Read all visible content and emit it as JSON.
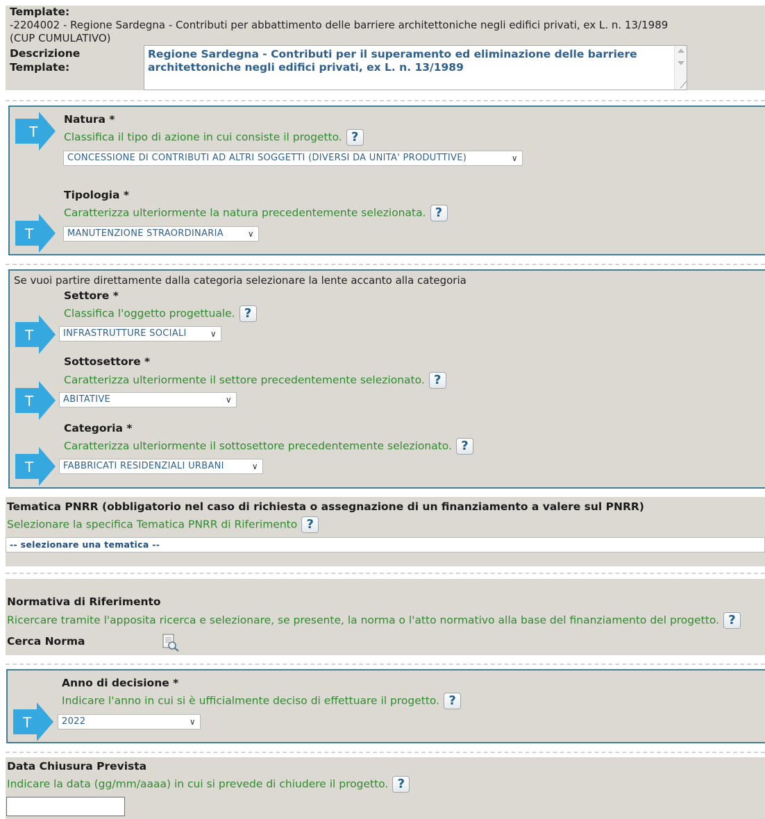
{
  "template": {
    "label": "Template:",
    "value_line1": "-2204002 - Regione Sardegna - Contributi per abbattimento delle barriere architettoniche negli edifici privati, ex L. n. 13/1989",
    "value_line2": "(CUP CUMULATIVO)",
    "descr_label_1": "Descrizione",
    "descr_label_2": "Template:",
    "descr_line1": "Regione Sardegna - Contributi per il superamento ed eliminazione delle barriere",
    "descr_line2": "architettoniche negli edifici privati, ex L. n. 13/1989"
  },
  "natura": {
    "label": "Natura *",
    "hint": "Classifica il tipo di azione in cui consiste il progetto.",
    "value": "CONCESSIONE DI CONTRIBUTI AD ALTRI SOGGETTI (DIVERSI DA UNITA' PRODUTTIVE)"
  },
  "tipologia": {
    "label": "Tipologia *",
    "hint": "Caratterizza ulteriormente la natura precedentemente selezionata.",
    "value": "MANUTENZIONE STRAORDINARIA"
  },
  "category_intro": "Se vuoi partire direttamente dalla categoria selezionare la lente accanto alla categoria",
  "settore": {
    "label": "Settore *",
    "hint": "Classifica l'oggetto progettuale.",
    "value": "INFRASTRUTTURE SOCIALI"
  },
  "sottosettore": {
    "label": "Sottosettore *",
    "hint": "Caratterizza ulteriormente il settore precedentemente selezionato.",
    "value": "ABITATIVE"
  },
  "categoria": {
    "label": "Categoria *",
    "hint": "Caratterizza ulteriormente il sottosettore precedentemente selezionato.",
    "value": "FABBRICATI RESIDENZIALI URBANI"
  },
  "pnrr": {
    "label": "Tematica PNRR (obbligatorio nel caso di richiesta o assegnazione di un finanziamento a valere sul PNRR)",
    "hint": "Selezionare la specifica Tematica PNRR di Riferimento",
    "value": "-- selezionare una tematica --"
  },
  "normativa": {
    "label": "Normativa di Riferimento",
    "hint": "Ricercare tramite l'apposita ricerca e selezionare, se presente, la norma o l'atto normativo alla base del finanziamento del progetto.",
    "search_label": "Cerca Norma"
  },
  "anno": {
    "label": "Anno di decisione *",
    "hint": "Indicare l'anno in cui si è ufficialmente deciso di effettuare il progetto.",
    "value": "2022"
  },
  "chiusura": {
    "label": "Data Chiusura Prevista",
    "hint": "Indicare la data (gg/mm/aaaa) in cui si prevede di chiudere il progetto.",
    "value": ""
  },
  "icons": {
    "help": "?",
    "t_badge": "T",
    "chevron": "∨"
  },
  "colors": {
    "panel_bg": "#dcd9d3",
    "panel_border": "#3f7c99",
    "hint_green": "#2e8b2e",
    "arrow_blue": "#35a8e0"
  }
}
